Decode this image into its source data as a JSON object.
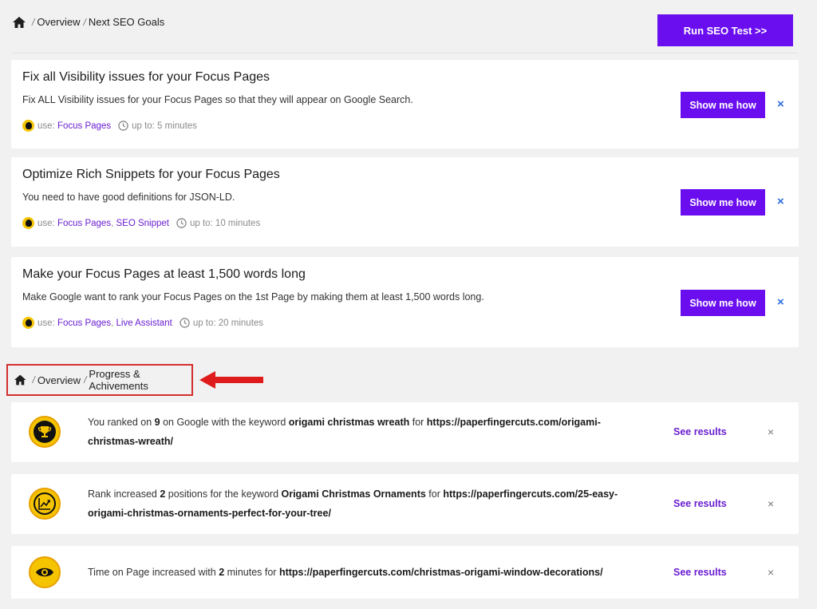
{
  "breadcrumb_top": {
    "home_icon": "home-icon",
    "items": [
      "Overview",
      "Next SEO Goals"
    ]
  },
  "breadcrumb_mid": {
    "home_icon": "home-icon",
    "items": [
      "Overview",
      "Progress & Achivements"
    ]
  },
  "run_button": {
    "label": "Run SEO Test >>"
  },
  "goals": [
    {
      "title": "Fix all Visibility issues for your Focus Pages",
      "description": "Fix ALL Visibility issues for your Focus Pages so that they will appear on Google Search.",
      "use_label": "use:",
      "links": [
        "Focus Pages"
      ],
      "time": "up to: 5 minutes",
      "button": "Show me how",
      "close": "×"
    },
    {
      "title": "Optimize Rich Snippets for your Focus Pages",
      "description": "You need to have good definitions for JSON-LD.",
      "use_label": "use:",
      "links": [
        "Focus Pages",
        "SEO Snippet"
      ],
      "link_sep": ",",
      "time": "up to: 10 minutes",
      "button": "Show me how",
      "close": "×"
    },
    {
      "title": "Make your Focus Pages at least 1,500 words long",
      "description": "Make Google want to rank your Focus Pages on the 1st Page by making them at least 1,500 words long.",
      "use_label": "use:",
      "links": [
        "Focus Pages",
        "Live Assistant"
      ],
      "link_sep": ",",
      "time": "up to: 20 minutes",
      "button": "Show me how",
      "close": "×"
    }
  ],
  "achievements": [
    {
      "icon": "trophy-icon",
      "parts": [
        "You ranked on ",
        "9",
        " on Google with the keyword ",
        "origami christmas wreath",
        " for ",
        "https://paperfingercuts.com/origami-christmas-wreath/"
      ],
      "link": "See results",
      "close": "×"
    },
    {
      "icon": "chart-up-icon",
      "parts": [
        "Rank increased ",
        "2",
        " positions for the keyword ",
        "Origami Christmas Ornaments",
        " for ",
        "https://paperfingercuts.com/25-easy-origami-christmas-ornaments-perfect-for-your-tree/"
      ],
      "link": "See results",
      "close": "×"
    },
    {
      "icon": "eye-icon",
      "parts": [
        "Time on Page increased with ",
        "2",
        " minutes for ",
        "https://paperfingercuts.com/christmas-origami-window-decorations/"
      ],
      "link": "See results",
      "close": "×"
    }
  ],
  "colors": {
    "accent": "#6a0ef0",
    "link": "#6a1ed0",
    "highlight_box": "#d32f2f",
    "badge": "#f5c400"
  }
}
